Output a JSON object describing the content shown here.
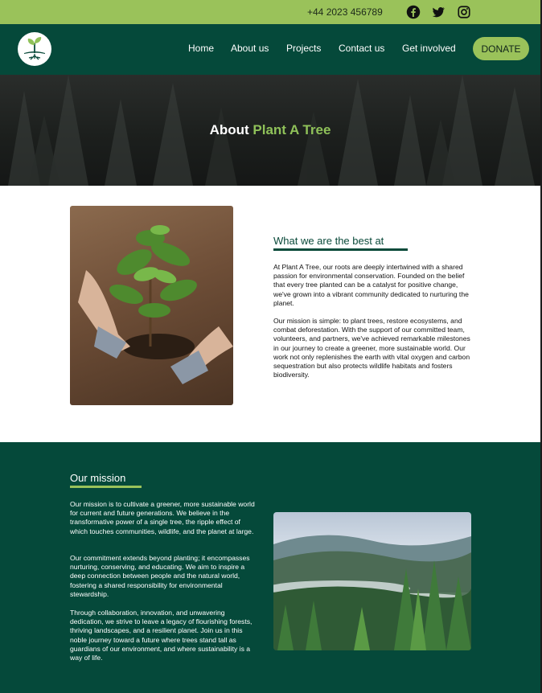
{
  "topbar": {
    "phone": "+44 2023 456789",
    "social_icons": [
      "facebook-icon",
      "twitter-icon",
      "instagram-icon"
    ],
    "color": "#9ac25a"
  },
  "nav": {
    "links": [
      "Home",
      "About us",
      "Projects",
      "Contact us",
      "Get involved"
    ],
    "donate_label": "DONATE",
    "background": "#05493a"
  },
  "hero": {
    "title_prefix": "About",
    "title_accent": "Plant A Tree"
  },
  "about": {
    "heading": "What we are the best at",
    "paragraphs": [
      "At Plant A Tree, our roots are deeply intertwined with a shared passion for environmental conservation. Founded on the belief that every tree planted can be a catalyst for positive change, we've grown into a vibrant community dedicated to nurturing the planet.",
      "Our mission is simple: to plant trees, restore ecosystems, and combat deforestation. With the support of our committed team, volunteers, and partners, we've achieved remarkable milestones in our journey to create a greener, more sustainable world. Our work not only replenishes the earth with vital oxygen and carbon sequestration but also protects wildlife habitats and fosters biodiversity."
    ]
  },
  "mission": {
    "heading": "Our mission",
    "paragraphs": [
      "Our mission is to cultivate a greener, more sustainable world for current and future generations. We believe in the transformative power of a single tree, the ripple effect of which touches communities, wildlife, and the planet at large.",
      "Our commitment extends beyond planting; it encompasses nurturing, conserving, and educating. We aim to inspire a deep connection between people and the natural world, fostering a shared responsibility for environmental stewardship.",
      "Through collaboration, innovation, and unwavering dedication, we strive to leave a legacy of flourishing forests, thriving landscapes, and a resilient planet. Join us in this noble journey toward a future where trees stand tall as guardians of our environment, and where sustainability is a way of life."
    ]
  },
  "colors": {
    "accent_green": "#9ac25a",
    "dark_green": "#05493a"
  }
}
